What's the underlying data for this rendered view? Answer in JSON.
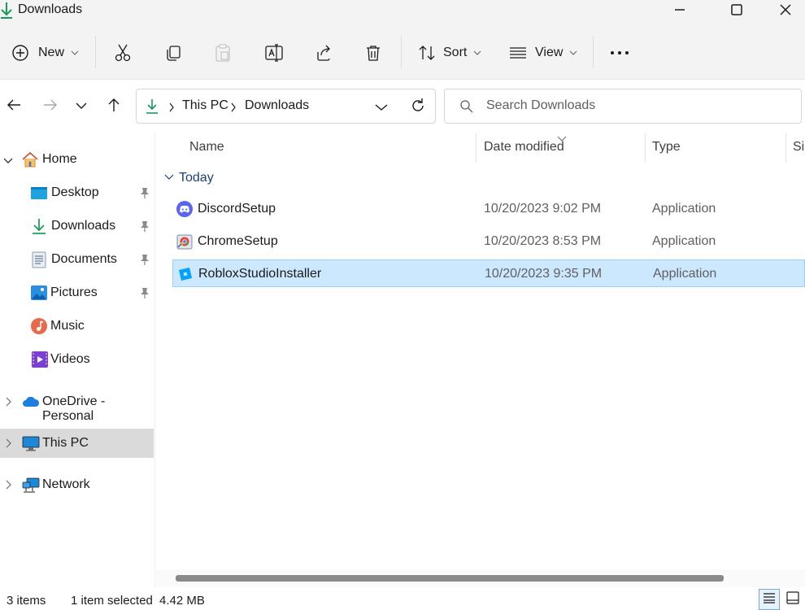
{
  "window": {
    "title": "Downloads",
    "icon": "download-arrow-icon",
    "controls": [
      "minimize-icon",
      "maximize-icon",
      "close-icon"
    ]
  },
  "toolbar": {
    "new_label": "New",
    "sort_label": "Sort",
    "view_label": "View",
    "icons": [
      "plus-circle-icon",
      "cut-icon",
      "copy-icon",
      "paste-icon",
      "rename-icon",
      "share-icon",
      "delete-icon",
      "sort-icon",
      "view-list-icon",
      "more-icon"
    ]
  },
  "address": {
    "crumbs": [
      "This PC",
      "Downloads"
    ],
    "search_placeholder": "Search Downloads"
  },
  "nav": {
    "items": [
      {
        "label": "Home",
        "icon": "home-icon",
        "expandable": true,
        "pinned": false
      },
      {
        "label": "Desktop",
        "icon": "desktop-folder-icon",
        "pinned": true
      },
      {
        "label": "Downloads",
        "icon": "download-arrow-icon",
        "pinned": true
      },
      {
        "label": "Documents",
        "icon": "documents-icon",
        "pinned": true
      },
      {
        "label": "Pictures",
        "icon": "pictures-icon",
        "pinned": true
      },
      {
        "label": "Music",
        "icon": "music-icon",
        "pinned": false
      },
      {
        "label": "Videos",
        "icon": "videos-icon",
        "pinned": false
      },
      {
        "label": "OneDrive - Personal",
        "icon": "onedrive-cloud-icon",
        "expandable": true
      },
      {
        "label": "This PC",
        "icon": "monitor-icon",
        "expandable": true,
        "selected": true
      },
      {
        "label": "Network",
        "icon": "network-icon",
        "expandable": true
      }
    ]
  },
  "columns": {
    "name": "Name",
    "date": "Date modified",
    "type": "Type",
    "size": "Si"
  },
  "groups": [
    {
      "label": "Today",
      "files": [
        {
          "name": "DiscordSetup",
          "date": "10/20/2023 9:02 PM",
          "type": "Application",
          "icon": "discord-icon",
          "selected": false
        },
        {
          "name": "ChromeSetup",
          "date": "10/20/2023 8:53 PM",
          "type": "Application",
          "icon": "chrome-installer-icon",
          "selected": false
        },
        {
          "name": "RobloxStudioInstaller",
          "date": "10/20/2023 9:35 PM",
          "type": "Application",
          "icon": "roblox-studio-icon",
          "selected": true
        }
      ]
    }
  ],
  "status": {
    "items": "3 items",
    "selected": "1 item selected",
    "size": "4.42 MB"
  },
  "colors": {
    "accent": "#0067c0",
    "selection": "#cce8ff",
    "download_green": "#1a9a58"
  }
}
